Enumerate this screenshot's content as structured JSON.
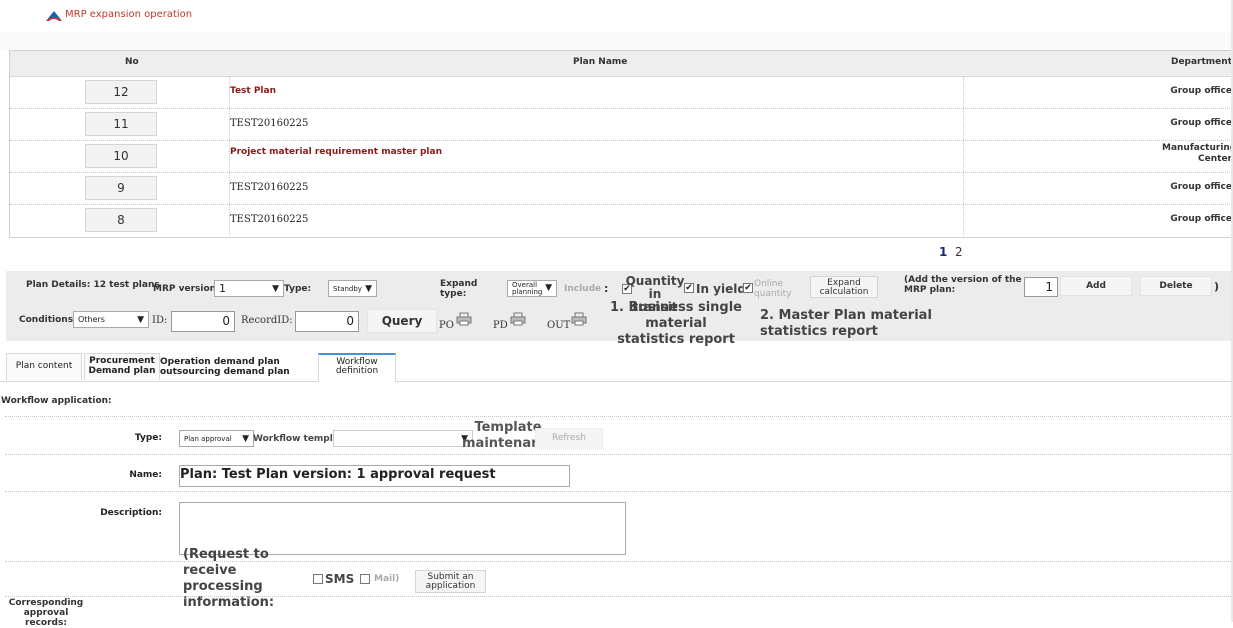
{
  "app": {
    "title": "MRP expansion operation"
  },
  "table": {
    "headers": {
      "no": "No",
      "plan_name": "Plan Name",
      "department": "Department"
    },
    "rows": [
      {
        "no": "12",
        "name": "Test Plan",
        "dept": "Group office",
        "style": "link"
      },
      {
        "no": "11",
        "name": "TEST20160225",
        "dept": "Group office",
        "style": "mono"
      },
      {
        "no": "10",
        "name": "Project material requirement master plan",
        "dept": "Manufacturing Center",
        "style": "link"
      },
      {
        "no": "9",
        "name": "TEST20160225",
        "dept": "Group office",
        "style": "mono"
      },
      {
        "no": "8",
        "name": "TEST20160225",
        "dept": "Group office",
        "style": "mono"
      }
    ]
  },
  "pagination": {
    "current": "1",
    "next": "2"
  },
  "details": {
    "plan_details": "Plan Details: 12 test plans",
    "mrp_version_label": "MRP version:",
    "mrp_version_value": "1",
    "type_label": "Type:",
    "type_value": "Standby",
    "expand_type_label": "Expand type:",
    "expand_type_value": "Overall planning",
    "include_label": "Include",
    "colon": ":",
    "qty_in_transit": "Quantity in transit",
    "in_yield": "In yield",
    "online_quantity": "Online quantity",
    "expand_calc": "Expand calculation",
    "add_version_label": "(Add the version of the MRP plan:",
    "add_version_value": "1",
    "add": "Add",
    "delete": "Delete",
    "close_paren": ")",
    "conditions_label": "Conditions:",
    "conditions_value": "Others",
    "id_label": "ID:",
    "id_value": "0",
    "record_id_label": "RecordID:",
    "record_id_value": "0",
    "query": "Query",
    "po": "PO",
    "pd": "PD",
    "out": "OUT",
    "report1": "1. Business single material statistics report",
    "report2": "2. Master Plan material statistics report"
  },
  "tabs": [
    {
      "label": "Plan content"
    },
    {
      "label": "Procurement Demand plan"
    },
    {
      "label": "Operation demand plan outsourcing demand plan"
    },
    {
      "label": "Workflow definition"
    }
  ],
  "workflow": {
    "section_label": "Workflow application:",
    "type_label": "Type:",
    "type_value": "Plan approval",
    "template_label": "Workflow template:",
    "template_maintenance": "Template maintenance",
    "refresh": "Refresh",
    "name_label": "Name:",
    "name_value": "Plan: Test Plan version: 1 approval request",
    "description_label": "Description:",
    "request_info": "(Request to receive processing information:",
    "sms": "SMS",
    "mail": "Mail)",
    "submit": "Submit an application",
    "approval_records": "Corresponding approval records:"
  },
  "colors": {
    "accent": "#4a90d9",
    "link": "#8b1a1a",
    "brand": "#c0392b"
  }
}
